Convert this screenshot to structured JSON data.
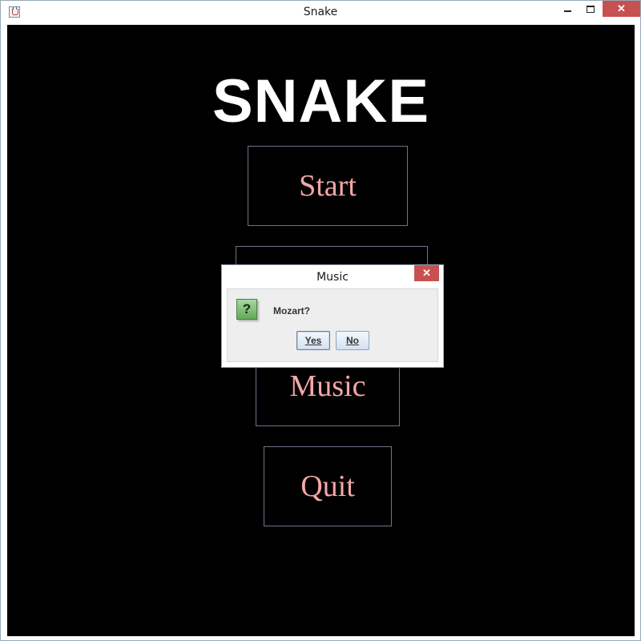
{
  "window": {
    "title": "Snake",
    "close_glyph": "✕"
  },
  "game": {
    "title": "SNAKE",
    "menu": {
      "start_label": "Start",
      "music_label": "Music",
      "quit_label": "Quit"
    },
    "colors": {
      "background": "#000000",
      "title": "#ffffff",
      "button_text": "#f4a7a7",
      "button_border": "#6f738a"
    }
  },
  "dialog": {
    "title": "Music",
    "close_glyph": "✕",
    "icon": "question-icon",
    "icon_glyph": "?",
    "message": "Mozart?",
    "yes_label": "Yes",
    "no_label": "No"
  }
}
